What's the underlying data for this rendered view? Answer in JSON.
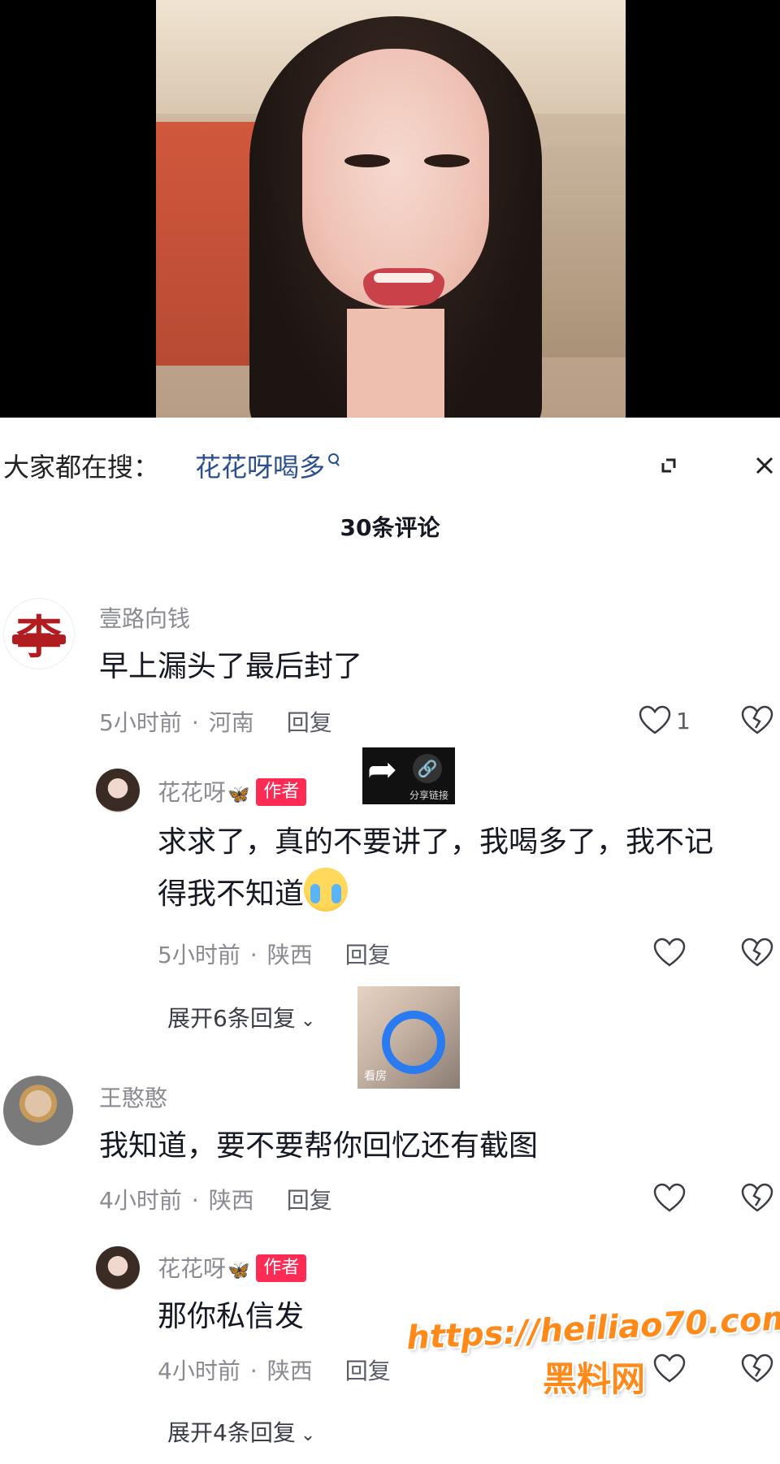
{
  "search": {
    "prefix": "大家都在搜：",
    "query": "花花呀喝多"
  },
  "header": {
    "comment_count": "30条评论"
  },
  "comments": [
    {
      "username": "壹路向钱",
      "text": "早上漏头了最后封了",
      "time": "5小时前",
      "location": "河南",
      "reply_label": "回复",
      "likes": "1",
      "replies": [
        {
          "username": "花花呀",
          "badge": "作者",
          "text_line1": "求求了，真的不要讲了，我喝多了，我不记",
          "text_line2": "得我不知道",
          "time": "5小时前",
          "location": "陕西",
          "reply_label": "回复"
        }
      ],
      "expand_label": "展开6条回复"
    },
    {
      "username": "王憨憨",
      "text": "我知道，要不要帮你回忆还有截图",
      "time": "4小时前",
      "location": "陕西",
      "reply_label": "回复",
      "replies": [
        {
          "username": "花花呀",
          "badge": "作者",
          "text_line1": "那你私信发",
          "time": "4小时前",
          "location": "陕西",
          "reply_label": "回复"
        }
      ],
      "expand_label": "展开4条回复"
    }
  ],
  "overlays": {
    "share_label": "分享链接",
    "app_label": "看房"
  },
  "watermark": {
    "url": "https://heiliao70.com",
    "site": "黑料网"
  },
  "avatars": {
    "li_char": "李"
  },
  "colors": {
    "author_badge": "#fe2c55",
    "search_link": "#2a4f8c",
    "watermark": "#ff8a1a"
  }
}
